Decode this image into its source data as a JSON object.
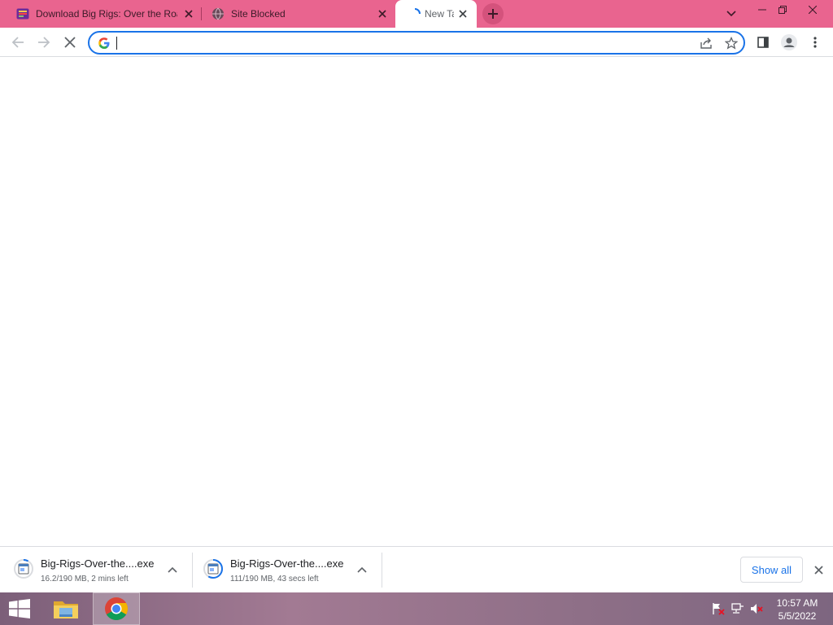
{
  "tabs": [
    {
      "title": "Download Big Rigs: Over the Road",
      "favicon": "game-favicon-icon",
      "close_label": "×"
    },
    {
      "title": "Site Blocked",
      "favicon": "globe-icon",
      "close_label": "×"
    },
    {
      "title": "New Tab",
      "favicon": "loading-icon",
      "close_label": "×",
      "active": true
    }
  ],
  "new_tab_label": "+",
  "omnibox": {
    "value": "",
    "placeholder": "",
    "search_engine_icon": "google-icon"
  },
  "downloads": [
    {
      "file_name": "Big-Rigs-Over-the....exe",
      "status": "16.2/190 MB, 2 mins left",
      "progress": 0.085
    },
    {
      "file_name": "Big-Rigs-Over-the....exe",
      "status": "111/190 MB, 43 secs left",
      "progress": 0.584
    }
  ],
  "shelf": {
    "show_all_label": "Show all"
  },
  "taskbar": {
    "time": "10:57 AM",
    "date": "5/5/2022"
  },
  "colors": {
    "tab_strip": "#e9648f",
    "accent": "#1a73e8"
  }
}
